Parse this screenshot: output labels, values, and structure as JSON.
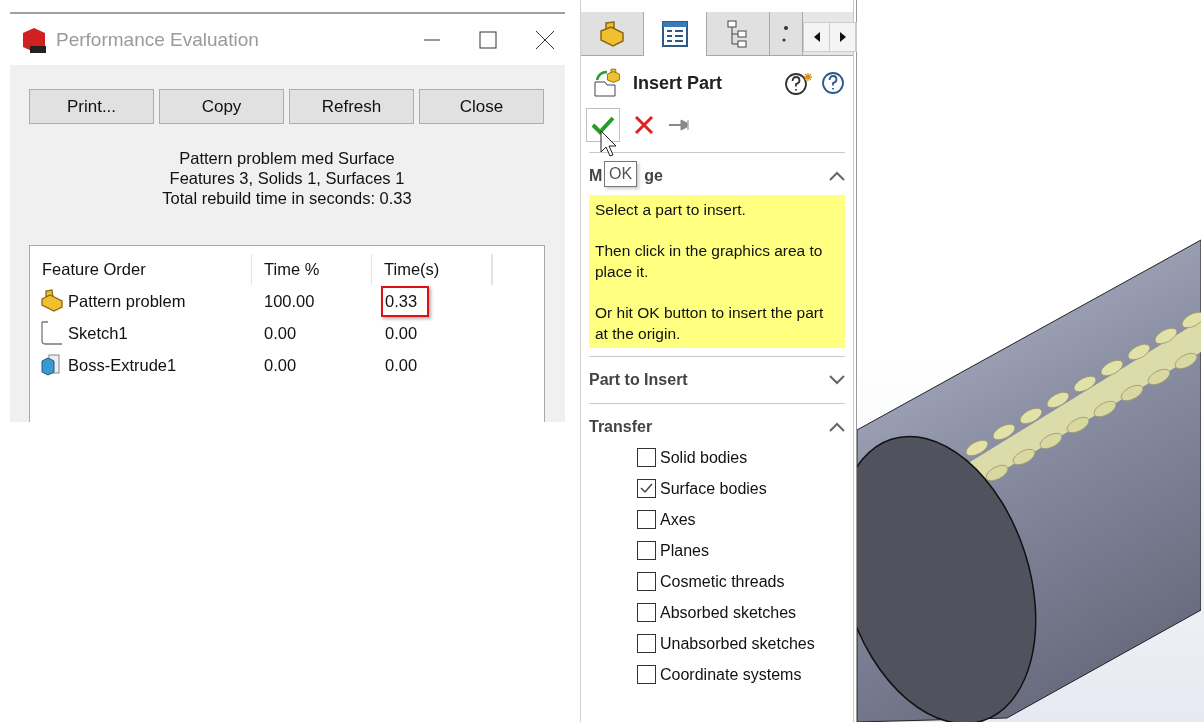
{
  "dialog": {
    "title": "Performance Evaluation",
    "buttons": [
      "Print...",
      "Copy",
      "Refresh",
      "Close"
    ],
    "summary": [
      "Pattern problem med Surface",
      "Features 3, Solids 1, Surfaces 1",
      "Total rebuild time in seconds: 0.33"
    ],
    "table": {
      "columns": [
        "Feature Order",
        "Time %",
        "Time(s)"
      ],
      "rows": [
        {
          "kind": "feature",
          "name": "Pattern problem",
          "percent": "100.00",
          "time": "0.33",
          "highlighted": true
        },
        {
          "kind": "sketch",
          "name": "Sketch1",
          "percent": "0.00",
          "time": "0.00",
          "highlighted": false
        },
        {
          "kind": "extrude",
          "name": "Boss-Extrude1",
          "percent": "0.00",
          "time": "0.00",
          "highlighted": false
        }
      ]
    }
  },
  "panel": {
    "tabs": [
      {
        "kind": "part",
        "selected": false
      },
      {
        "kind": "properties",
        "selected": true
      },
      {
        "kind": "tree",
        "selected": false
      },
      {
        "kind": "more",
        "selected": false
      }
    ],
    "title": "Insert Part",
    "tooltip": "OK",
    "sections": [
      {
        "kind": "message",
        "title_parts": [
          "M",
          "ge"
        ],
        "expanded": true,
        "paragraphs": [
          "Select a part to insert.",
          "Then click in the graphics area to place it.",
          "Or hit OK button to insert the part at the origin."
        ]
      },
      {
        "kind": "plain",
        "title": "Part to Insert",
        "expanded": false
      },
      {
        "kind": "options",
        "title": "Transfer",
        "expanded": true,
        "options": [
          {
            "label": "Solid bodies",
            "checked": false
          },
          {
            "label": "Surface bodies",
            "checked": true
          },
          {
            "label": "Axes",
            "checked": false
          },
          {
            "label": "Planes",
            "checked": false
          },
          {
            "label": "Cosmetic threads",
            "checked": false
          },
          {
            "label": "Absorbed sketches",
            "checked": false
          },
          {
            "label": "Unabsorbed sketches",
            "checked": false
          },
          {
            "label": "Coordinate systems",
            "checked": false
          }
        ]
      }
    ]
  }
}
